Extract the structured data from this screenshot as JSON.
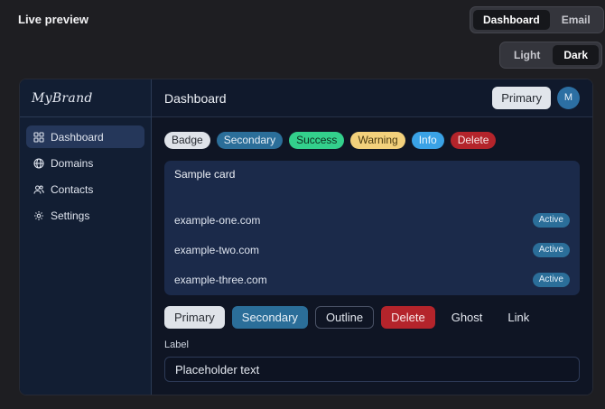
{
  "page": {
    "title": "Live preview"
  },
  "view_switch": {
    "options": [
      "Dashboard",
      "Email"
    ],
    "active": "Dashboard"
  },
  "theme_switch": {
    "options": [
      "Light",
      "Dark"
    ],
    "active": "Dark"
  },
  "preview": {
    "brand": "MyBrand",
    "sidebar": {
      "items": [
        {
          "label": "Dashboard",
          "icon": "grid-icon",
          "active": true
        },
        {
          "label": "Domains",
          "icon": "globe-icon",
          "active": false
        },
        {
          "label": "Contacts",
          "icon": "users-icon",
          "active": false
        },
        {
          "label": "Settings",
          "icon": "gear-icon",
          "active": false
        }
      ]
    },
    "topbar": {
      "title": "Dashboard",
      "primary_label": "Primary",
      "avatar_initial": "M"
    },
    "badges": [
      "Badge",
      "Secondary",
      "Success",
      "Warning",
      "Info",
      "Delete"
    ],
    "card": {
      "title": "Sample card",
      "rows": [
        {
          "domain": "example-one.com",
          "status": "Active"
        },
        {
          "domain": "example-two.com",
          "status": "Active"
        },
        {
          "domain": "example-three.com",
          "status": "Active"
        }
      ]
    },
    "buttons": [
      "Primary",
      "Secondary",
      "Outline",
      "Delete",
      "Ghost",
      "Link"
    ],
    "form": {
      "label": "Label",
      "placeholder": "Placeholder text"
    }
  },
  "colors": {
    "page_bg": "#1e1e22",
    "sidebar_bg": "#121e33",
    "card_bg": "#1b2a4a",
    "secondary": "#2b6e99",
    "success": "#33d08c",
    "warning": "#f3d17c",
    "info": "#3aa2e6",
    "danger": "#b4242b"
  }
}
